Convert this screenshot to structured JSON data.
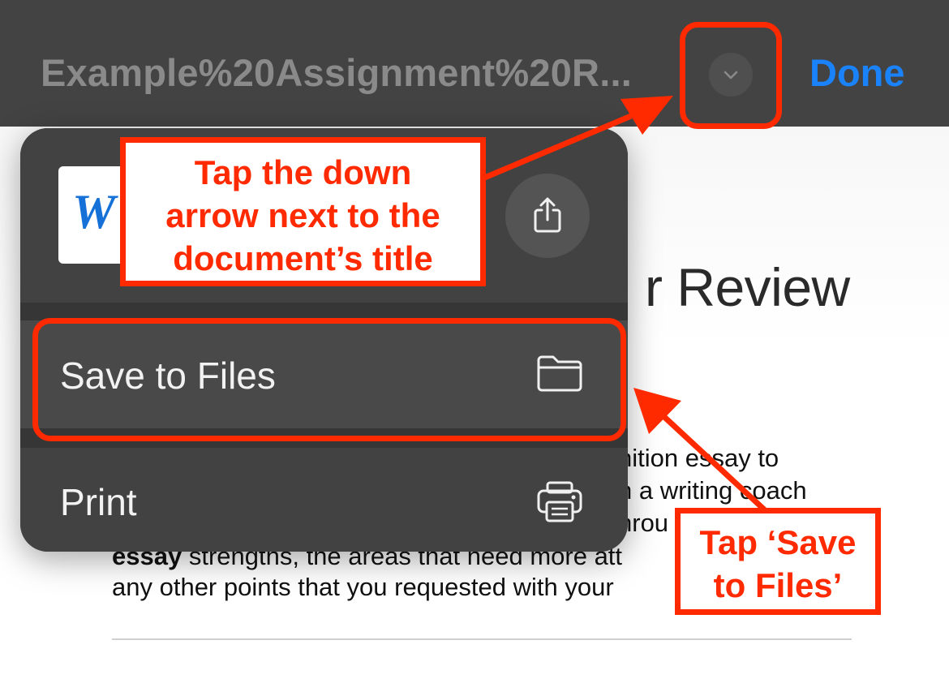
{
  "topbar": {
    "title": "Example%20Assignment%20R...",
    "done_label": "Done",
    "chevron_icon": "chevron-down-icon"
  },
  "document": {
    "heading_fragment": "r Review",
    "lines": [
      {
        "pre": "",
        "bold": "",
        "post": "nition essay to"
      },
      {
        "pre": "",
        "bold": "",
        "post": "n a writing coach"
      },
      {
        "pre": "",
        "bold": "",
        "post": "hrou"
      },
      {
        "pre": "",
        "bold": "essay",
        "post": " strengths, the areas that need more att"
      },
      {
        "pre": "any other points that you requested with your",
        "bold": "",
        "post": ""
      }
    ]
  },
  "menu": {
    "file_icon": "word-document-icon",
    "file_icon_letter": "W",
    "share_icon": "share-icon",
    "items": [
      {
        "label": "Save to Files",
        "icon": "folder-icon"
      },
      {
        "label": "Print",
        "icon": "printer-icon"
      }
    ]
  },
  "annotations": {
    "callout_1": [
      "Tap the down",
      "arrow next to the",
      "document’s title"
    ],
    "callout_2": [
      "Tap ‘Save",
      "to Files’"
    ],
    "accent_color": "#ff2a00"
  }
}
